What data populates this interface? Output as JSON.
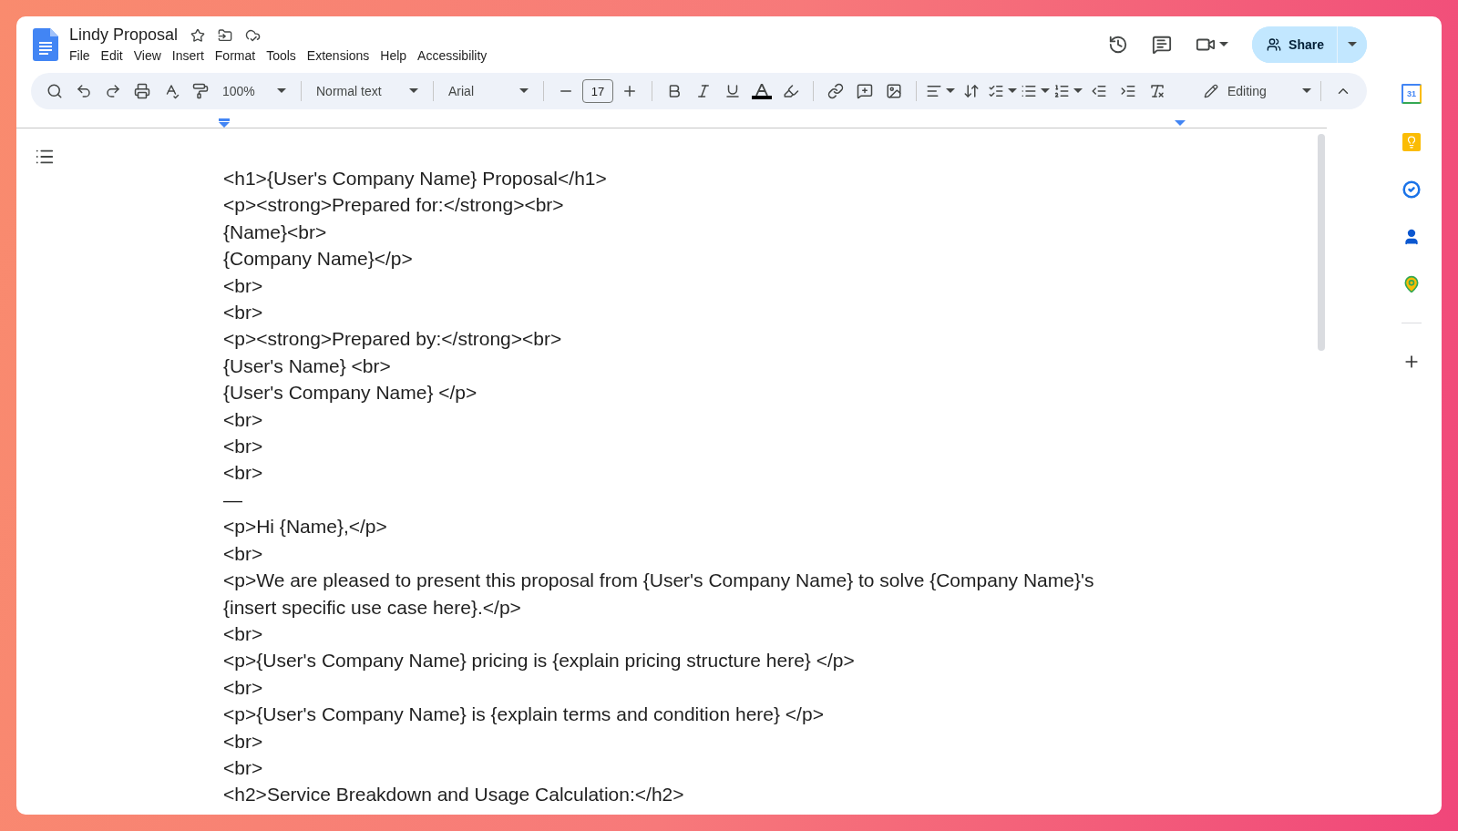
{
  "document_header": {
    "title": "Lindy Proposal",
    "menu": [
      "File",
      "Edit",
      "View",
      "Insert",
      "Format",
      "Tools",
      "Extensions",
      "Help",
      "Accessibility"
    ]
  },
  "header_actions": {
    "share": "Share"
  },
  "toolbar": {
    "zoom": "100%",
    "paragraph_style": "Normal text",
    "font": "Arial",
    "font_size": "17",
    "mode": "Editing"
  },
  "side_panel": {
    "calendar_label": "31"
  },
  "document": {
    "lines": [
      "<h1>{User's Company Name} Proposal</h1>",
      "<p><strong>Prepared for:</strong><br>",
      "{Name}<br>",
      "{Company Name}</p>",
      "<br>",
      "<br>",
      "<p><strong>Prepared by:</strong><br>",
      "{User's Name} <br>",
      "{User's Company Name} </p>",
      "<br>",
      "<br>",
      "<br>",
      "—",
      "<p>Hi {Name},</p>",
      "<br>",
      "<p>We are pleased to present this proposal from {User's Company Name} to solve {Company Name}'s",
      "{insert specific use case here}.</p>",
      "<br>",
      "<p>{User's Company Name} pricing is {explain pricing structure here} </p>",
      "<br>",
      "<p>{User's Company Name} is {explain terms and condition here} </p>",
      "<br>",
      "<br>",
      "<h2>Service Breakdown and Usage Calculation:</h2>"
    ]
  }
}
